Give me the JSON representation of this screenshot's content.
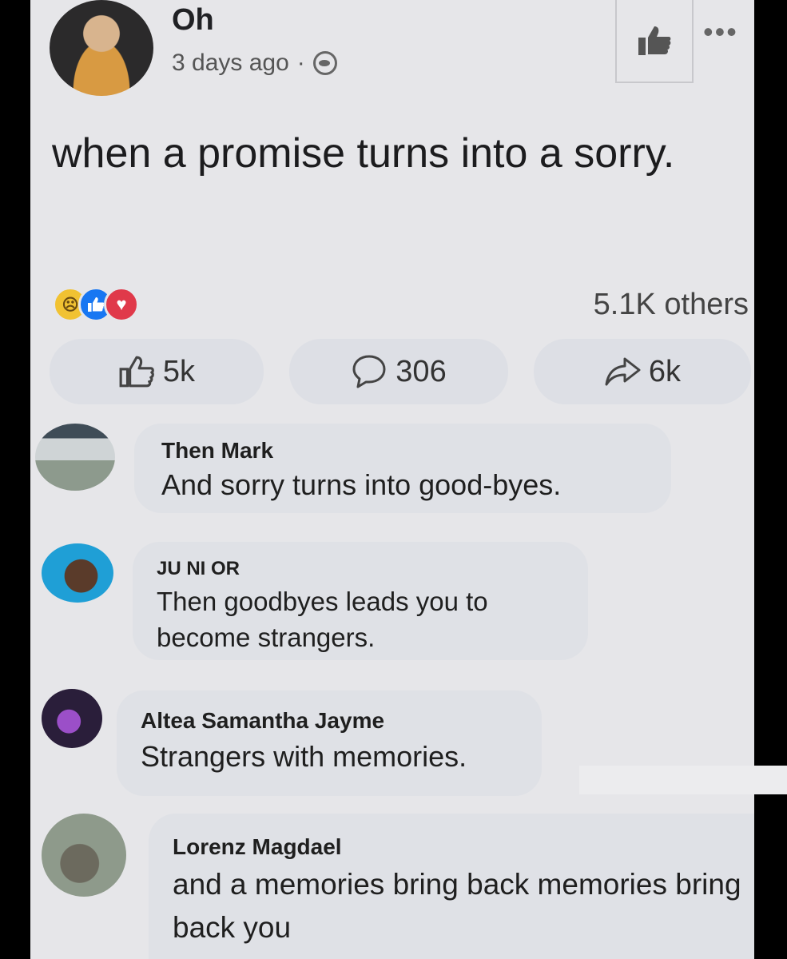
{
  "post": {
    "author": "Oh",
    "time": "3 days ago",
    "separator": "·",
    "text": "when a promise turns into a sorry.",
    "reactions_count": "5.1K others",
    "reaction_icons": [
      "sad-reaction-icon",
      "like-reaction-icon",
      "love-reaction-icon"
    ],
    "actions": {
      "like_count": "5k",
      "comment_count": "306",
      "share_count": "6k"
    }
  },
  "comments": [
    {
      "name": "Then Mark",
      "text": "And sorry turns into good-byes."
    },
    {
      "name": "JU NI OR",
      "text": "Then goodbyes leads you to become strangers."
    },
    {
      "name": "Altea Samantha Jayme",
      "text": "Strangers with memories."
    },
    {
      "name": "Lorenz Magdael",
      "text": "and a memories bring back memories bring back you"
    }
  ],
  "colors": {
    "background": "#e6e6e9",
    "bubble": "#dfe1e6",
    "like_blue": "#1877f2",
    "love_red": "#e0394a",
    "sad_yellow": "#f1c232"
  }
}
